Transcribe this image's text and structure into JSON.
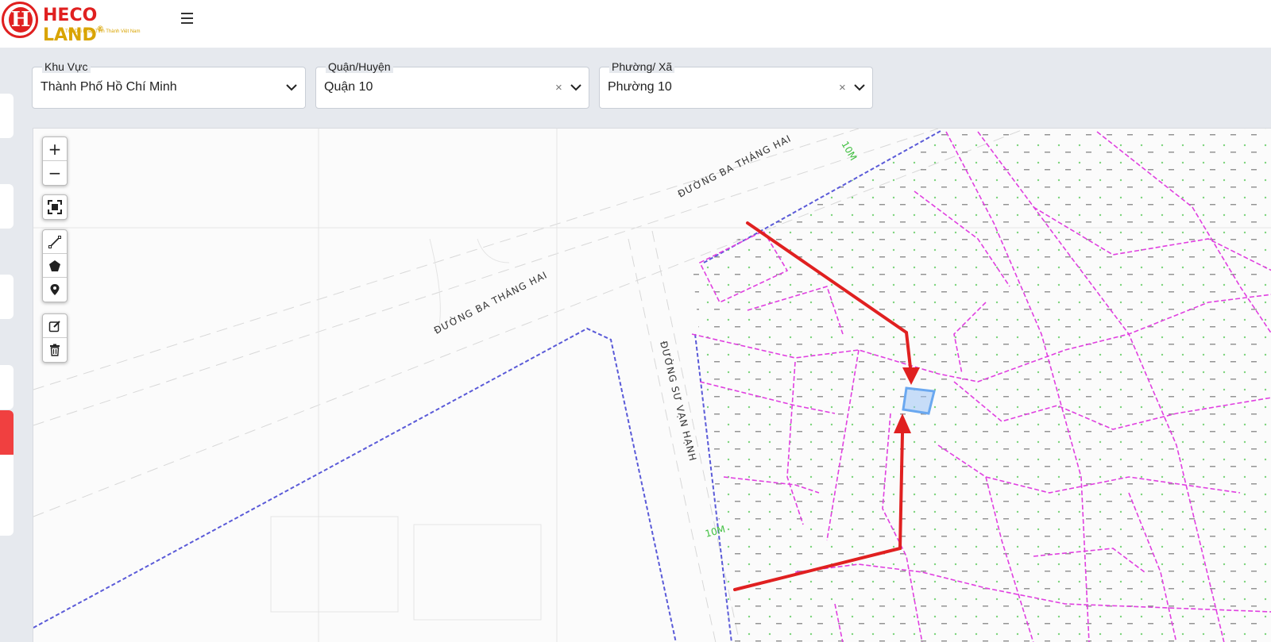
{
  "header": {
    "brand_part1": "HECO",
    "brand_part2": "LAND",
    "brand_reg": "®",
    "tagline": "Trải Dài Khắp Tỉnh Thành Việt Nam",
    "logo_letter": "H"
  },
  "filters": {
    "region": {
      "label": "Khu Vực",
      "value": "Thành Phố Hồ Chí Minh"
    },
    "district": {
      "label": "Quận/Huyện",
      "value": "Quận 10",
      "clear": "×"
    },
    "ward": {
      "label": "Phường/ Xã",
      "value": "Phường 10",
      "clear": "×"
    }
  },
  "map": {
    "zoom_in": "+",
    "zoom_out": "−",
    "labels": {
      "street_1a": "ĐƯỜNG BA THÁNG HAI",
      "street_1b": "ĐƯỜNG BA THÁNG HAI",
      "street_2": "ĐƯỜNG SƯ VẠN HẠNH",
      "width_1": "10M",
      "width_2": "10M"
    },
    "colors": {
      "parcel_boundary": "#e040e0",
      "ward_boundary": "#5a5ad8",
      "arrow": "#e02020",
      "highlight": "#6aa8f0"
    }
  },
  "colors": {
    "brand_red": "#e02020",
    "brand_gold": "#d9a400"
  }
}
